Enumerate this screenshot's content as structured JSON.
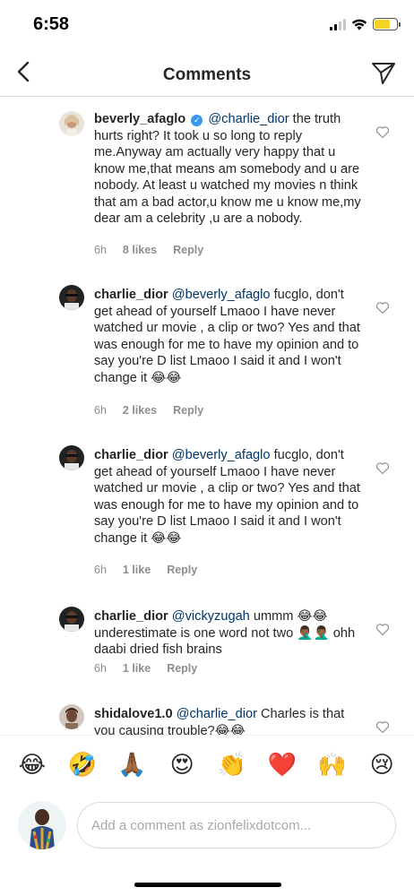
{
  "status": {
    "time": "6:58"
  },
  "nav": {
    "title": "Comments"
  },
  "comments": [
    {
      "username": "beverly_afaglo",
      "verified": true,
      "mention": "@charlie_dior",
      "text": " the truth hurts right? It took u so long to reply me.Anyway am actually very happy that u know me,that means am somebody and u are nobody. At least u watched my movies n think that am a bad actor,u know me u know me,my dear am a celebrity ,u are a nobody.",
      "time": "6h",
      "likes": "8 likes",
      "reply": "Reply",
      "avatar": "beverly-avatar"
    },
    {
      "username": "charlie_dior",
      "verified": false,
      "mention": "@beverly_afaglo",
      "text": " fucglo, don't get ahead of yourself Lmaoo I have never watched ur movie , a clip or two? Yes and that was enough for me to have my opinion and to say you're D list Lmaoo I said it and I won't change it 😂😂",
      "time": "6h",
      "likes": "2 likes",
      "reply": "Reply",
      "avatar": "charlie-avatar"
    },
    {
      "username": "charlie_dior",
      "verified": false,
      "mention": "@beverly_afaglo",
      "text": " fucglo, don't get ahead of yourself Lmaoo I have never watched ur movie , a clip or two? Yes and that was enough for me to have my opinion and to say you're D list Lmaoo I said it and I won't change it 😂😂",
      "time": "6h",
      "likes": "1 like",
      "reply": "Reply",
      "avatar": "charlie-avatar"
    },
    {
      "username": "charlie_dior",
      "verified": false,
      "mention": "@vickyzugah",
      "text": " ummm 😂😂 underestimate is one word not two 🤦🏾‍♂️🤦🏾‍♂️ ohh daabi dried fish brains",
      "time": "6h",
      "likes": "1 like",
      "reply": "Reply",
      "avatar": "charlie-avatar"
    },
    {
      "username": "shidalove1.0",
      "verified": false,
      "mention": "@charlie_dior",
      "text": " Charles is that you causing trouble?😂😂",
      "time": "",
      "likes": "",
      "reply": "",
      "avatar": "shida-avatar"
    }
  ],
  "emoji_bar": [
    "😂",
    "🤣",
    "🙏🏾",
    "😍",
    "👏",
    "❤️",
    "🙌",
    "😢"
  ],
  "composer": {
    "placeholder": "Add a comment as zionfelixdotcom..."
  }
}
